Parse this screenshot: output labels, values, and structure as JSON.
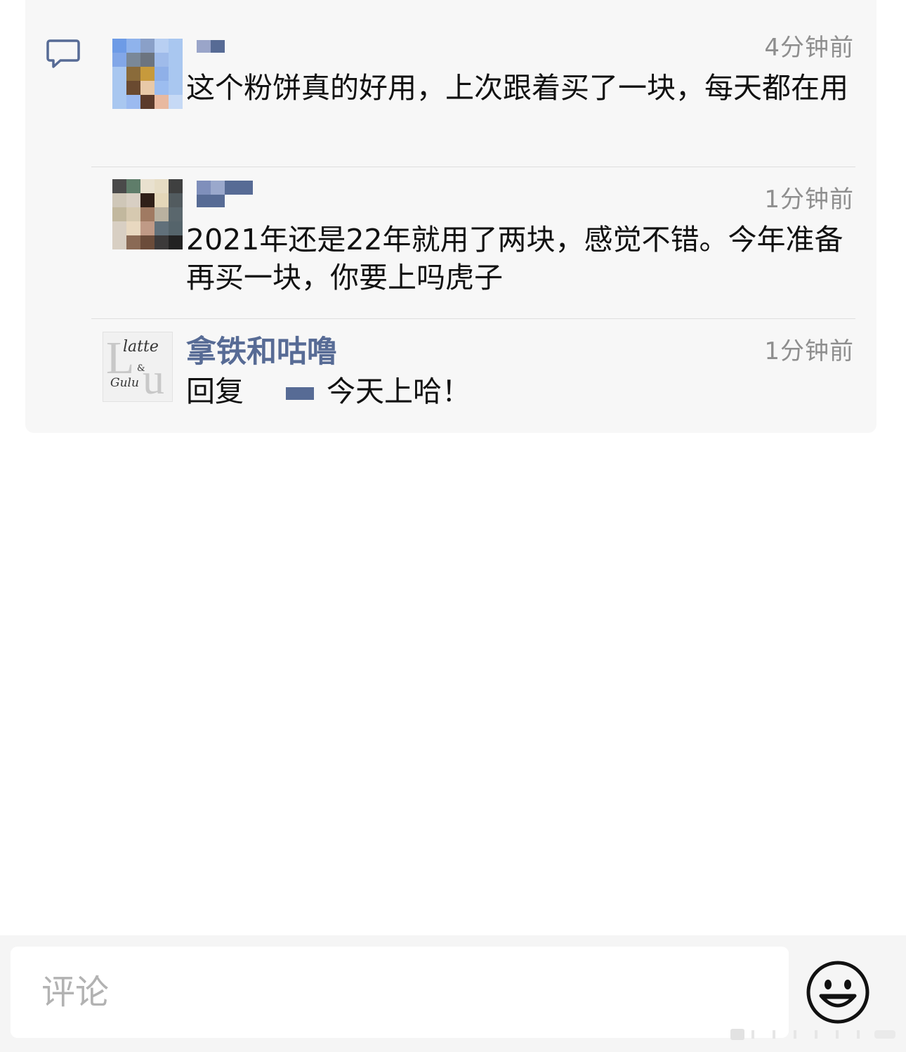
{
  "comments": [
    {
      "time": "4分钟前",
      "text": "这个粉饼真的好用，上次跟着买了一块，每天都在用"
    },
    {
      "time": "1分钟前",
      "text": "2021年还是22年就用了两块，感觉不错。今年准备再买一块，你要上吗虎子"
    },
    {
      "author": "拿铁和咕噜",
      "time": "1分钟前",
      "reply_prefix": "回复",
      "reply_text": "今天上哈！",
      "avatar_text": [
        "latte",
        "&",
        "Gulu"
      ]
    }
  ],
  "input": {
    "placeholder": "评论"
  },
  "icons": {
    "comment": "comment-bubble-icon",
    "emoji": "smiley-face-icon"
  },
  "colors": {
    "author_name": "#576b95",
    "timestamp": "#8e8e8e",
    "panel_bg": "#f7f7f7"
  }
}
